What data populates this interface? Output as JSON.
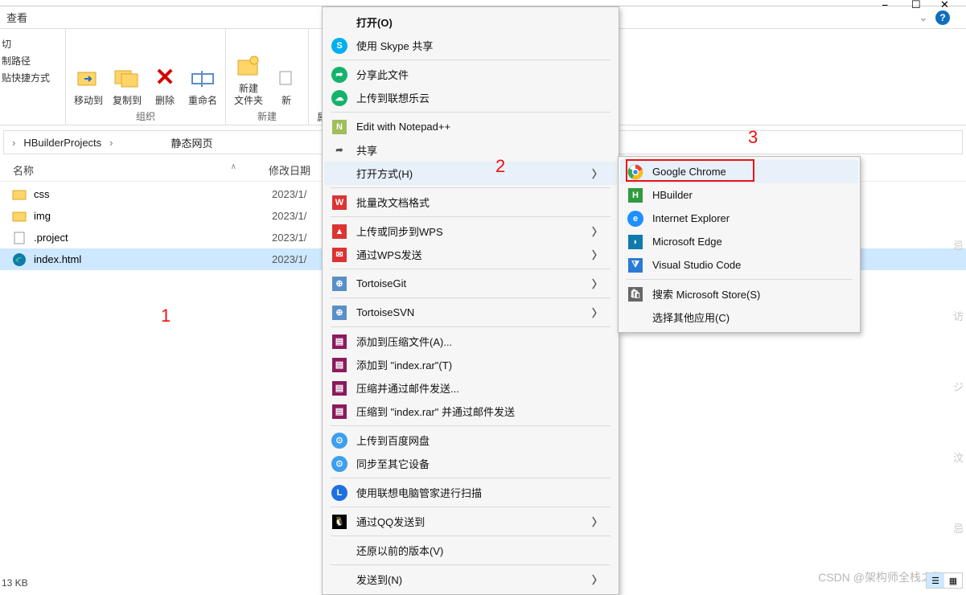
{
  "window": {
    "minimize": "⎯",
    "maximize": "☐",
    "close": "✕"
  },
  "viewTab": "查看",
  "help": "?",
  "ribbon": {
    "group0": {
      "line1": "切",
      "line2": "制路径",
      "line3": "贴快捷方式"
    },
    "group1": {
      "moveTo": "移动到",
      "copyTo": "复制到",
      "delete": "删除",
      "rename": "重命名",
      "label": "组织"
    },
    "group2": {
      "newFolder": "新建\n文件夹",
      "new": "新",
      "label": "新建"
    },
    "group3": {
      "prop": "属"
    }
  },
  "breadcrumb": {
    "a": "HBuilderProjects",
    "b": "静态网页",
    "sep": "›"
  },
  "columns": {
    "name": "名称",
    "date": "修改日期",
    "sort": "∧"
  },
  "files": [
    {
      "icon": "folder",
      "name": "css",
      "date": "2023/1/"
    },
    {
      "icon": "folder",
      "name": "img",
      "date": "2023/1/"
    },
    {
      "icon": "file",
      "name": ".project",
      "date": "2023/1/"
    },
    {
      "icon": "edge",
      "name": "index.html",
      "date": "2023/1/",
      "selected": true
    }
  ],
  "status": "13 KB",
  "watermark": "CSDN @架构师全栈之路",
  "annotations": {
    "a1": "1",
    "a2": "2",
    "a3": "3"
  },
  "contextMenu": [
    {
      "type": "item",
      "icon": "",
      "label": "打开(O)",
      "bold": true
    },
    {
      "type": "item",
      "icon": "skype",
      "label": "使用 Skype 共享"
    },
    {
      "type": "sep"
    },
    {
      "type": "item",
      "icon": "share1",
      "label": "分享此文件"
    },
    {
      "type": "item",
      "icon": "cloud",
      "label": "上传到联想乐云"
    },
    {
      "type": "sep"
    },
    {
      "type": "item",
      "icon": "npp",
      "label": "Edit with Notepad++"
    },
    {
      "type": "item",
      "icon": "share2",
      "label": "共享"
    },
    {
      "type": "item",
      "icon": "",
      "label": "打开方式(H)",
      "arrow": true,
      "highlight": true
    },
    {
      "type": "sep"
    },
    {
      "type": "item",
      "icon": "wps",
      "label": "批量改文档格式"
    },
    {
      "type": "sep"
    },
    {
      "type": "item",
      "icon": "wpsup",
      "label": "上传或同步到WPS",
      "arrow": true
    },
    {
      "type": "item",
      "icon": "wpssend",
      "label": "通过WPS发送",
      "arrow": true
    },
    {
      "type": "sep"
    },
    {
      "type": "item",
      "icon": "tgit",
      "label": "TortoiseGit",
      "arrow": true
    },
    {
      "type": "sep"
    },
    {
      "type": "item",
      "icon": "tsvn",
      "label": "TortoiseSVN",
      "arrow": true
    },
    {
      "type": "sep"
    },
    {
      "type": "item",
      "icon": "rar",
      "label": "添加到压缩文件(A)..."
    },
    {
      "type": "item",
      "icon": "rar",
      "label": "添加到 \"index.rar\"(T)"
    },
    {
      "type": "item",
      "icon": "rar",
      "label": "压缩并通过邮件发送..."
    },
    {
      "type": "item",
      "icon": "rar",
      "label": "压缩到 \"index.rar\" 并通过邮件发送"
    },
    {
      "type": "sep"
    },
    {
      "type": "item",
      "icon": "baidu",
      "label": "上传到百度网盘"
    },
    {
      "type": "item",
      "icon": "baidu",
      "label": "同步至其它设备"
    },
    {
      "type": "sep"
    },
    {
      "type": "item",
      "icon": "lenovo",
      "label": "使用联想电脑管家进行扫描"
    },
    {
      "type": "sep"
    },
    {
      "type": "item",
      "icon": "qq",
      "label": "通过QQ发送到",
      "arrow": true
    },
    {
      "type": "sep"
    },
    {
      "type": "item",
      "icon": "",
      "label": "还原以前的版本(V)"
    },
    {
      "type": "sep"
    },
    {
      "type": "item",
      "icon": "",
      "label": "发送到(N)",
      "arrow": true
    }
  ],
  "subMenu": [
    {
      "type": "item",
      "icon": "chrome",
      "label": "Google Chrome",
      "highlight": true
    },
    {
      "type": "item",
      "icon": "hbuilder",
      "label": "HBuilder"
    },
    {
      "type": "item",
      "icon": "ie",
      "label": "Internet Explorer"
    },
    {
      "type": "item",
      "icon": "edge",
      "label": "Microsoft Edge"
    },
    {
      "type": "item",
      "icon": "vscode",
      "label": "Visual Studio Code"
    },
    {
      "type": "sep"
    },
    {
      "type": "item",
      "icon": "store",
      "label": "搜索 Microsoft Store(S)"
    },
    {
      "type": "item",
      "icon": "",
      "label": "选择其他应用(C)"
    }
  ]
}
